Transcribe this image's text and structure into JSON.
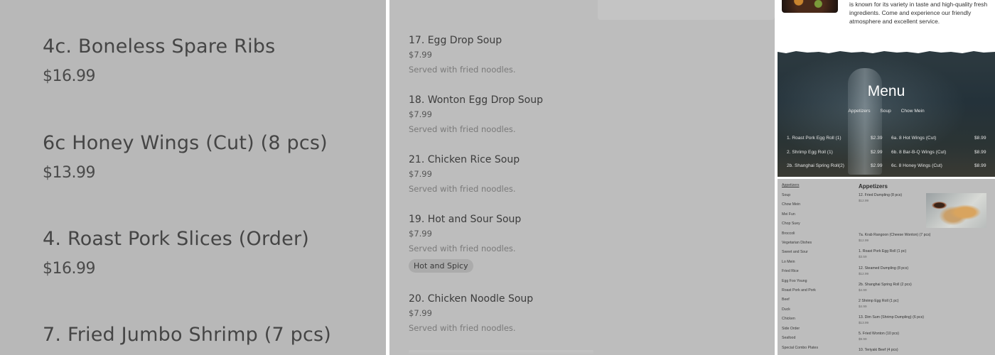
{
  "panel1": {
    "items": [
      {
        "name": "4c. Boneless Spare Ribs",
        "price": "$16.99"
      },
      {
        "name": "6c Honey Wings (Cut) (8 pcs)",
        "price": "$13.99"
      },
      {
        "name": "4. Roast Pork Slices (Order)",
        "price": "$16.99"
      },
      {
        "name": "7. Fried Jumbo Shrimp (7 pcs)",
        "price": ""
      }
    ]
  },
  "panel2": {
    "items": [
      {
        "name": "17. Egg Drop Soup",
        "price": "$7.99",
        "desc": "Served with fried noodles."
      },
      {
        "name": "18. Wonton Egg Drop Soup",
        "price": "$7.99",
        "desc": "Served with fried noodles."
      },
      {
        "name": "21. Chicken Rice Soup",
        "price": "$7.99",
        "desc": "Served with fried noodles."
      },
      {
        "name": "19. Hot and Sour Soup",
        "price": "$7.99",
        "desc": "Served with fried noodles.",
        "tag": "Hot and Spicy"
      },
      {
        "name": "20. Chicken Noodle Soup",
        "price": "$7.99",
        "desc": "Served with fried noodles."
      }
    ]
  },
  "site": {
    "about_lines": [
      "is known for its variety in taste and high-quality fresh",
      "ingredients. Come and experience our friendly",
      "atmosphere and excellent service."
    ],
    "menu_title": "Menu",
    "menu_tabs": [
      "Appetizers",
      "Soup",
      "Chow Mein"
    ],
    "hero_rows": [
      {
        "left_name": "1. Roast Pork Egg Roll (1)",
        "left_price": "$2.39",
        "right_name": "6a. 8 Hot Wings (Cut)",
        "right_price": "$8.99"
      },
      {
        "left_name": "2. Shrimp Egg Roll (1)",
        "left_price": "$2.99",
        "right_name": "6b. 8 Bar-B-Q Wings (Cut)",
        "right_price": "$8.99"
      },
      {
        "left_name": "2b. Shanghai Spring Roll(2)",
        "left_price": "$2.99",
        "right_name": "6c. 8 Honey Wings (Cut)",
        "right_price": "$8.99"
      }
    ]
  },
  "fullmenu": {
    "categories": [
      "Appetizers",
      "Soup",
      "Chow Mein",
      "Mei Fun",
      "Chop Suey",
      "Broccoli",
      "Vegetarian Dishes",
      "Sweet and Sour",
      "Lo Mein",
      "Fried Rice",
      "Egg Foo Young",
      "Roast Pork and Pork",
      "Beef",
      "Duck",
      "Chicken",
      "Side Order",
      "Seafood",
      "Special Combo Plates"
    ],
    "section_title": "Appetizers",
    "dishes": [
      {
        "name": "12. Fried Dumpling (8 pcs)",
        "price": "$12.99"
      },
      {
        "name": "7a. Krab Rangoon (Cheese Wonton) (7 pcs)",
        "price": "$12.99"
      },
      {
        "name": "1. Roast Pork Egg Roll (1 pc)",
        "price": "$3.59"
      },
      {
        "name": "12. Steamed Dumpling (8 pcs)",
        "price": "$12.99"
      },
      {
        "name": "2b. Shanghai Spring Roll (2 pcs)",
        "price": "$4.99"
      },
      {
        "name": "2 Shrimp Egg Roll (1 pc)",
        "price": "$4.99"
      },
      {
        "name": "13. Dim Sum (Shrimp Dumpling) (6 pcs)",
        "price": "$13.99"
      },
      {
        "name": "5. Fried Wonton (10 pcs)",
        "price": "$9.99"
      },
      {
        "name": "10. Teriyaki Beef (4 pcs)",
        "price": ""
      }
    ]
  }
}
